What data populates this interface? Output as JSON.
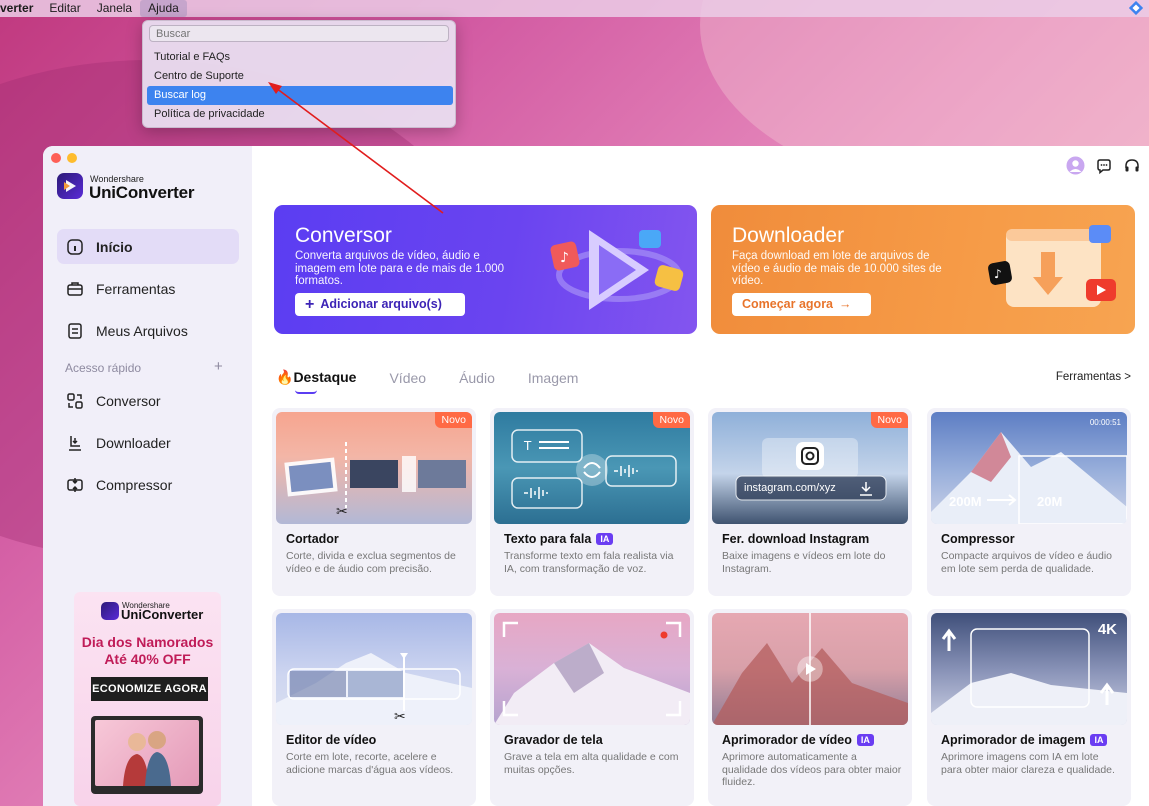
{
  "menubar": {
    "items": [
      "verter",
      "Editar",
      "Janela",
      "Ajuda"
    ],
    "active_index": 3
  },
  "help_menu": {
    "search_placeholder": "Buscar",
    "items": [
      "Tutorial e FAQs",
      "Centro de Suporte",
      "Buscar log",
      "Política de privacidade"
    ],
    "selected_index": 2
  },
  "app": {
    "brand_small": "Wondershare",
    "brand_big": "UniConverter"
  },
  "sidebar": {
    "nav": [
      {
        "label": "Início",
        "icon": "home-icon",
        "active": true
      },
      {
        "label": "Ferramentas",
        "icon": "toolbox-icon",
        "active": false
      },
      {
        "label": "Meus Arquivos",
        "icon": "files-icon",
        "active": false
      }
    ],
    "quick_access_label": "Acesso rápido",
    "quick_access_plus": "+",
    "quick": [
      {
        "label": "Conversor",
        "icon": "converter-icon"
      },
      {
        "label": "Downloader",
        "icon": "downloader-icon"
      },
      {
        "label": "Compressor",
        "icon": "compressor-icon"
      }
    ],
    "promo": {
      "brand_small": "Wondershare",
      "brand_big": "UniConverter",
      "title_line1": "Dia dos Namorados",
      "title_line2": "Até 40% OFF",
      "cta": "ECONOMIZE AGORA"
    }
  },
  "banners": {
    "converter": {
      "title": "Conversor",
      "desc": "Converta arquivos de vídeo, áudio e imagem em lote para e de mais de 1.000 formatos.",
      "button": "Adicionar arquivo(s)",
      "button_icon": "+"
    },
    "downloader": {
      "title": "Downloader",
      "desc": "Faça download em lote de arquivos de vídeo e áudio de mais de 10.000 sites de vídeo.",
      "button": "Começar agora",
      "button_icon": "→"
    }
  },
  "tabs": {
    "items": [
      "Destaque",
      "Vídeo",
      "Áudio",
      "Imagem"
    ],
    "active_index": 0,
    "tools_link": "Ferramentas >"
  },
  "cards": [
    {
      "title": "Cortador",
      "desc": "Corte, divida e exclua segmentos de vídeo e de áudio com precisão.",
      "badge": "Novo",
      "ia": false
    },
    {
      "title": "Texto para fala",
      "desc": "Transforme texto em fala realista via IA, com transformação de voz.",
      "badge": "Novo",
      "ia": true
    },
    {
      "title": "Fer. download Instagram",
      "desc": "Baixe imagens e vídeos em lote do Instagram.",
      "badge": "Novo",
      "ia": false,
      "thumb_text": "instagram.com/xyz"
    },
    {
      "title": "Compressor",
      "desc": "Compacte arquivos de vídeo e áudio em lote sem perda de qualidade.",
      "badge": "",
      "ia": false,
      "thumb_from": "200M",
      "thumb_to": "20M",
      "thumb_time": "00:00:51"
    },
    {
      "title": "Editor de vídeo",
      "desc": "Corte em lote, recorte, acelere e adicione marcas d'água aos vídeos.",
      "badge": "",
      "ia": false
    },
    {
      "title": "Gravador de tela",
      "desc": "Grave a tela em alta qualidade e com muitas opções.",
      "badge": "",
      "ia": false
    },
    {
      "title": "Aprimorador de vídeo",
      "desc": "Aprimore automaticamente a qualidade dos vídeos para obter maior fluidez.",
      "badge": "",
      "ia": true
    },
    {
      "title": "Aprimorador de imagem",
      "desc": "Aprimore imagens com IA em lote para obter maior clareza e qualidade.",
      "badge": "",
      "ia": true,
      "thumb_text": "4K"
    }
  ],
  "ia_label": "IA",
  "colors": {
    "accent": "#5b3df2",
    "converter_banner": "#6a44f0",
    "downloader_banner": "#f69b47",
    "new_badge": "#ff6a45",
    "menu_selection": "#3d83ef",
    "annotation_arrow": "#e11d1d"
  }
}
